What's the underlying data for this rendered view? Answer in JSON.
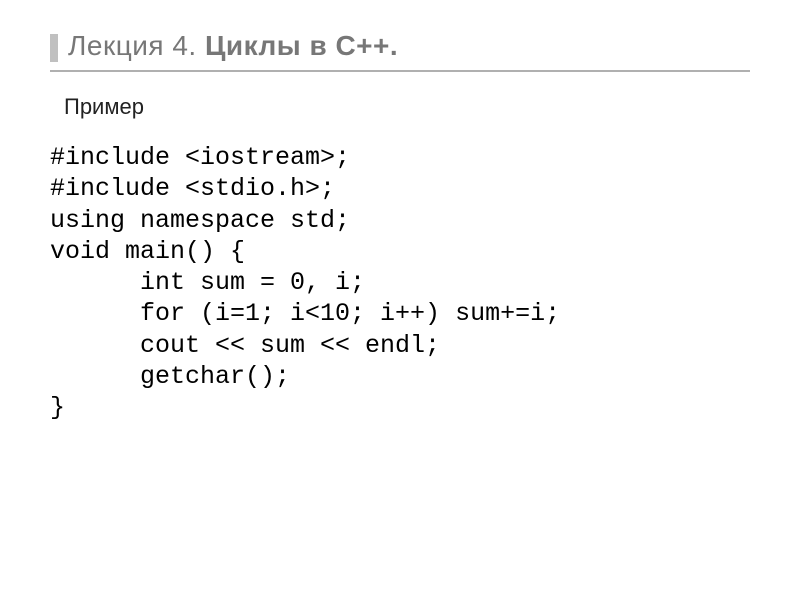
{
  "header": {
    "title_prefix": "Лекция ",
    "title_number": "4",
    "title_sep": ". ",
    "title_bold": "Циклы в С++."
  },
  "body": {
    "example_label": "Пример"
  },
  "code": {
    "l1": "#include <iostream>;",
    "l2": "#include <stdio.h>;",
    "l3": "using namespace std;",
    "l4": "void main() {",
    "l5": "      int sum = 0, i;",
    "l6": "      for (i=1; i<10; i++) sum+=i;",
    "l7": "      cout << sum << endl;",
    "l8": "      getchar();",
    "l9": "}"
  }
}
